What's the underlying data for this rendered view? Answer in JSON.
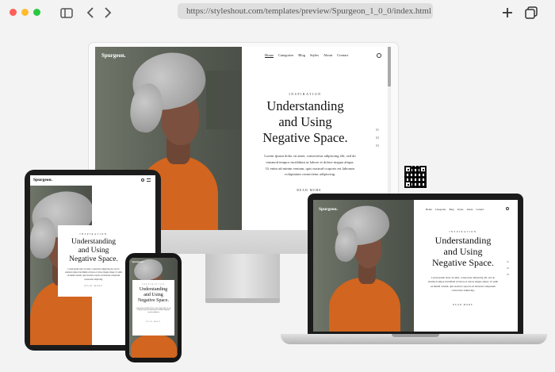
{
  "browser": {
    "url": "https://styleshout.com/templates/preview/Spurgeon_1_0_0/index.html",
    "icons": [
      "sidebar-toggle-icon",
      "back-icon",
      "forward-icon",
      "new-tab-icon",
      "tab-overview-icon"
    ]
  },
  "site": {
    "brand": "Spurgeon.",
    "nav": [
      "Home",
      "Categories",
      "Blog",
      "Styles",
      "About",
      "Contact"
    ],
    "eyebrow": "Inspiration",
    "headline_line1": "Understanding",
    "headline_line2": "and Using",
    "headline_line3": "Negative Space.",
    "body": "Lorem ipsum dolor sit amet, consectetur adipiscing elit, sed do eiusmod tempor incididunt ut labore et dolore magna aliqua. Ut enim ad minim veniam, quis nostrud corporis est laborum voluptatum consectetur adipiscing.",
    "read_more": "Read More",
    "colors": {
      "accent_sweater": "#d2651f",
      "backdrop": "#5c6258"
    }
  }
}
